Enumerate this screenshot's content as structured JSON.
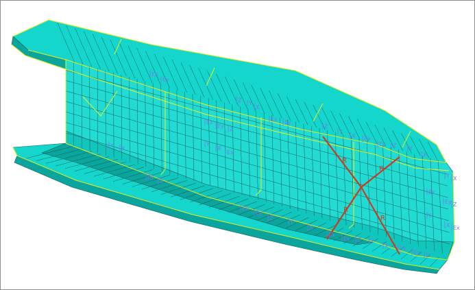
{
  "viewport": {
    "background": "#ffffff",
    "border_color": "#8c8c8c"
  },
  "model": {
    "shell_color": "#14d6cc",
    "shell_light": "#4fe7df",
    "shell_dark": "#0aa69e",
    "mesh_color": "#0f5a56",
    "feature_edge_color": "#e9ef1a",
    "rigid_link_color": "#c83c24",
    "bc_symbol_color": "#7a78e8"
  },
  "rigid_links": {
    "label": "R"
  },
  "boundary_labels": [
    "Ex",
    "Ey",
    "Z",
    "Y",
    "X"
  ]
}
